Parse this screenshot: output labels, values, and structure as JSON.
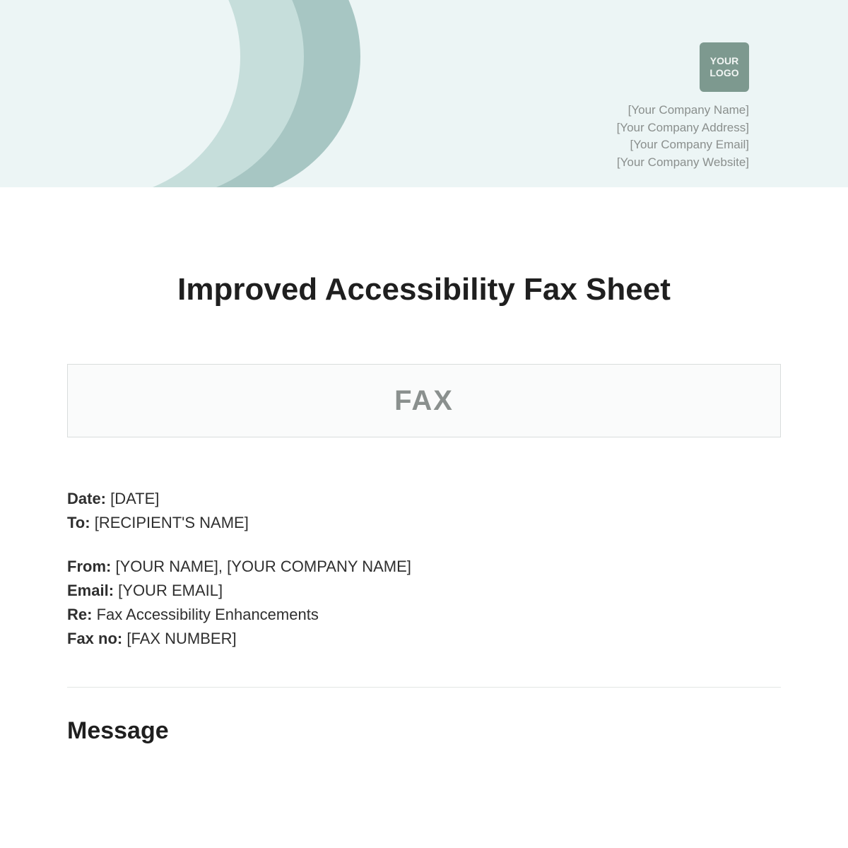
{
  "header": {
    "logo_line1": "YOUR",
    "logo_line2": "LOGO",
    "company_name": "[Your Company Name]",
    "company_address": "[Your Company Address]",
    "company_email": "[Your Company Email]",
    "company_website": "[Your Company Website]"
  },
  "title": "Improved Accessibility Fax Sheet",
  "fax_box_label": "FAX",
  "fields": {
    "date_label": "Date:",
    "date_value": "[DATE]",
    "to_label": "To:",
    "to_value": "[RECIPIENT'S NAME]",
    "from_label": "From:",
    "from_value": "[YOUR NAME], [YOUR COMPANY NAME]",
    "email_label": "Email:",
    "email_value": "[YOUR EMAIL]",
    "re_label": "Re:",
    "re_value": "Fax Accessibility Enhancements",
    "faxno_label": "Fax no:",
    "faxno_value": "[FAX NUMBER]"
  },
  "message_heading": "Message"
}
